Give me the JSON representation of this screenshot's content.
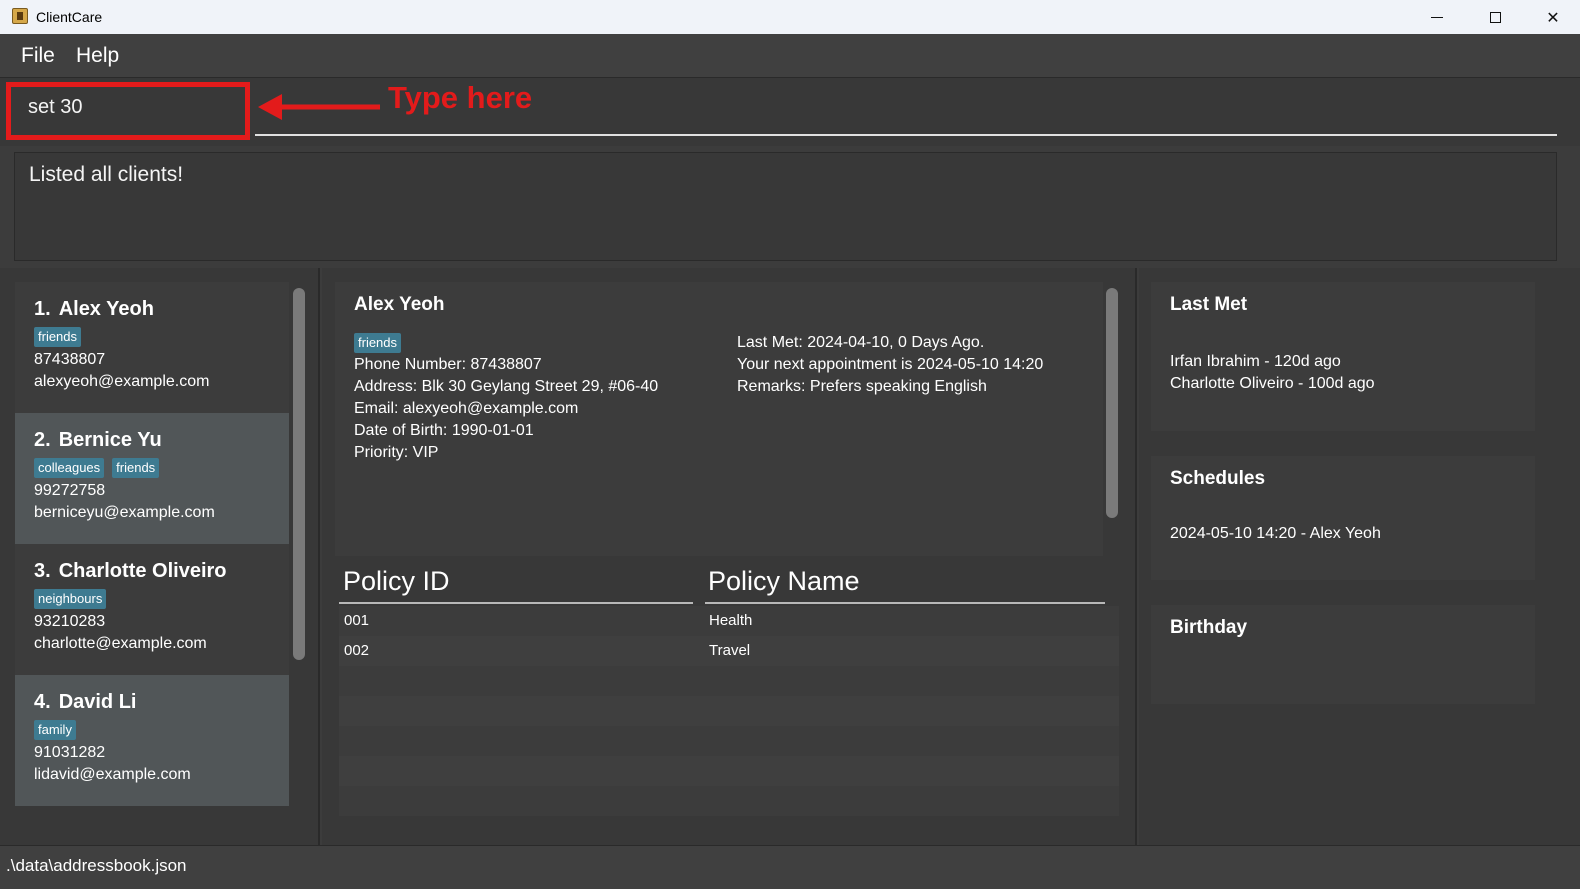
{
  "window": {
    "title": "ClientCare"
  },
  "menu": {
    "file": "File",
    "help": "Help"
  },
  "command": {
    "value": "set 30"
  },
  "annotation": {
    "text": "Type here",
    "color": "#e31b1b"
  },
  "result": {
    "text": "Listed all clients!"
  },
  "clients": [
    {
      "index": "1.",
      "name": "Alex Yeoh",
      "tags": [
        "friends"
      ],
      "phone": "87438807",
      "email": "alexyeoh@example.com"
    },
    {
      "index": "2.",
      "name": "Bernice Yu",
      "tags": [
        "colleagues",
        "friends"
      ],
      "phone": "99272758",
      "email": "berniceyu@example.com"
    },
    {
      "index": "3.",
      "name": "Charlotte Oliveiro",
      "tags": [
        "neighbours"
      ],
      "phone": "93210283",
      "email": "charlotte@example.com"
    },
    {
      "index": "4.",
      "name": "David Li",
      "tags": [
        "family"
      ],
      "phone": "91031282",
      "email": "lidavid@example.com"
    }
  ],
  "detail": {
    "name": "Alex Yeoh",
    "tag": "friends",
    "phone": "Phone Number: 87438807",
    "address": "Address: Blk 30 Geylang Street 29, #06-40",
    "email": "Email: alexyeoh@example.com",
    "dob": "Date of Birth: 1990-01-01",
    "priority": "Priority: VIP",
    "last_met": "Last Met: 2024-04-10, 0 Days Ago.",
    "next_appointment": "Your next appointment is 2024-05-10 14:20",
    "remarks": "Remarks: Prefers speaking English"
  },
  "policies": {
    "headers": [
      "Policy ID",
      "Policy Name"
    ],
    "rows": [
      {
        "id": "001",
        "name": "Health"
      },
      {
        "id": "002",
        "name": "Travel"
      }
    ]
  },
  "last_met_panel": {
    "title": "Last Met",
    "items": [
      "Irfan Ibrahim - 120d ago",
      "Charlotte Oliveiro - 100d ago"
    ]
  },
  "schedules_panel": {
    "title": "Schedules",
    "items": [
      "2024-05-10 14:20 - Alex Yeoh"
    ]
  },
  "birthday_panel": {
    "title": "Birthday"
  },
  "status": {
    "path": ".\\data\\addressbook.json"
  },
  "colors": {
    "tag": "#3e7b91",
    "background": "#383838",
    "selected_card": "#515658"
  }
}
